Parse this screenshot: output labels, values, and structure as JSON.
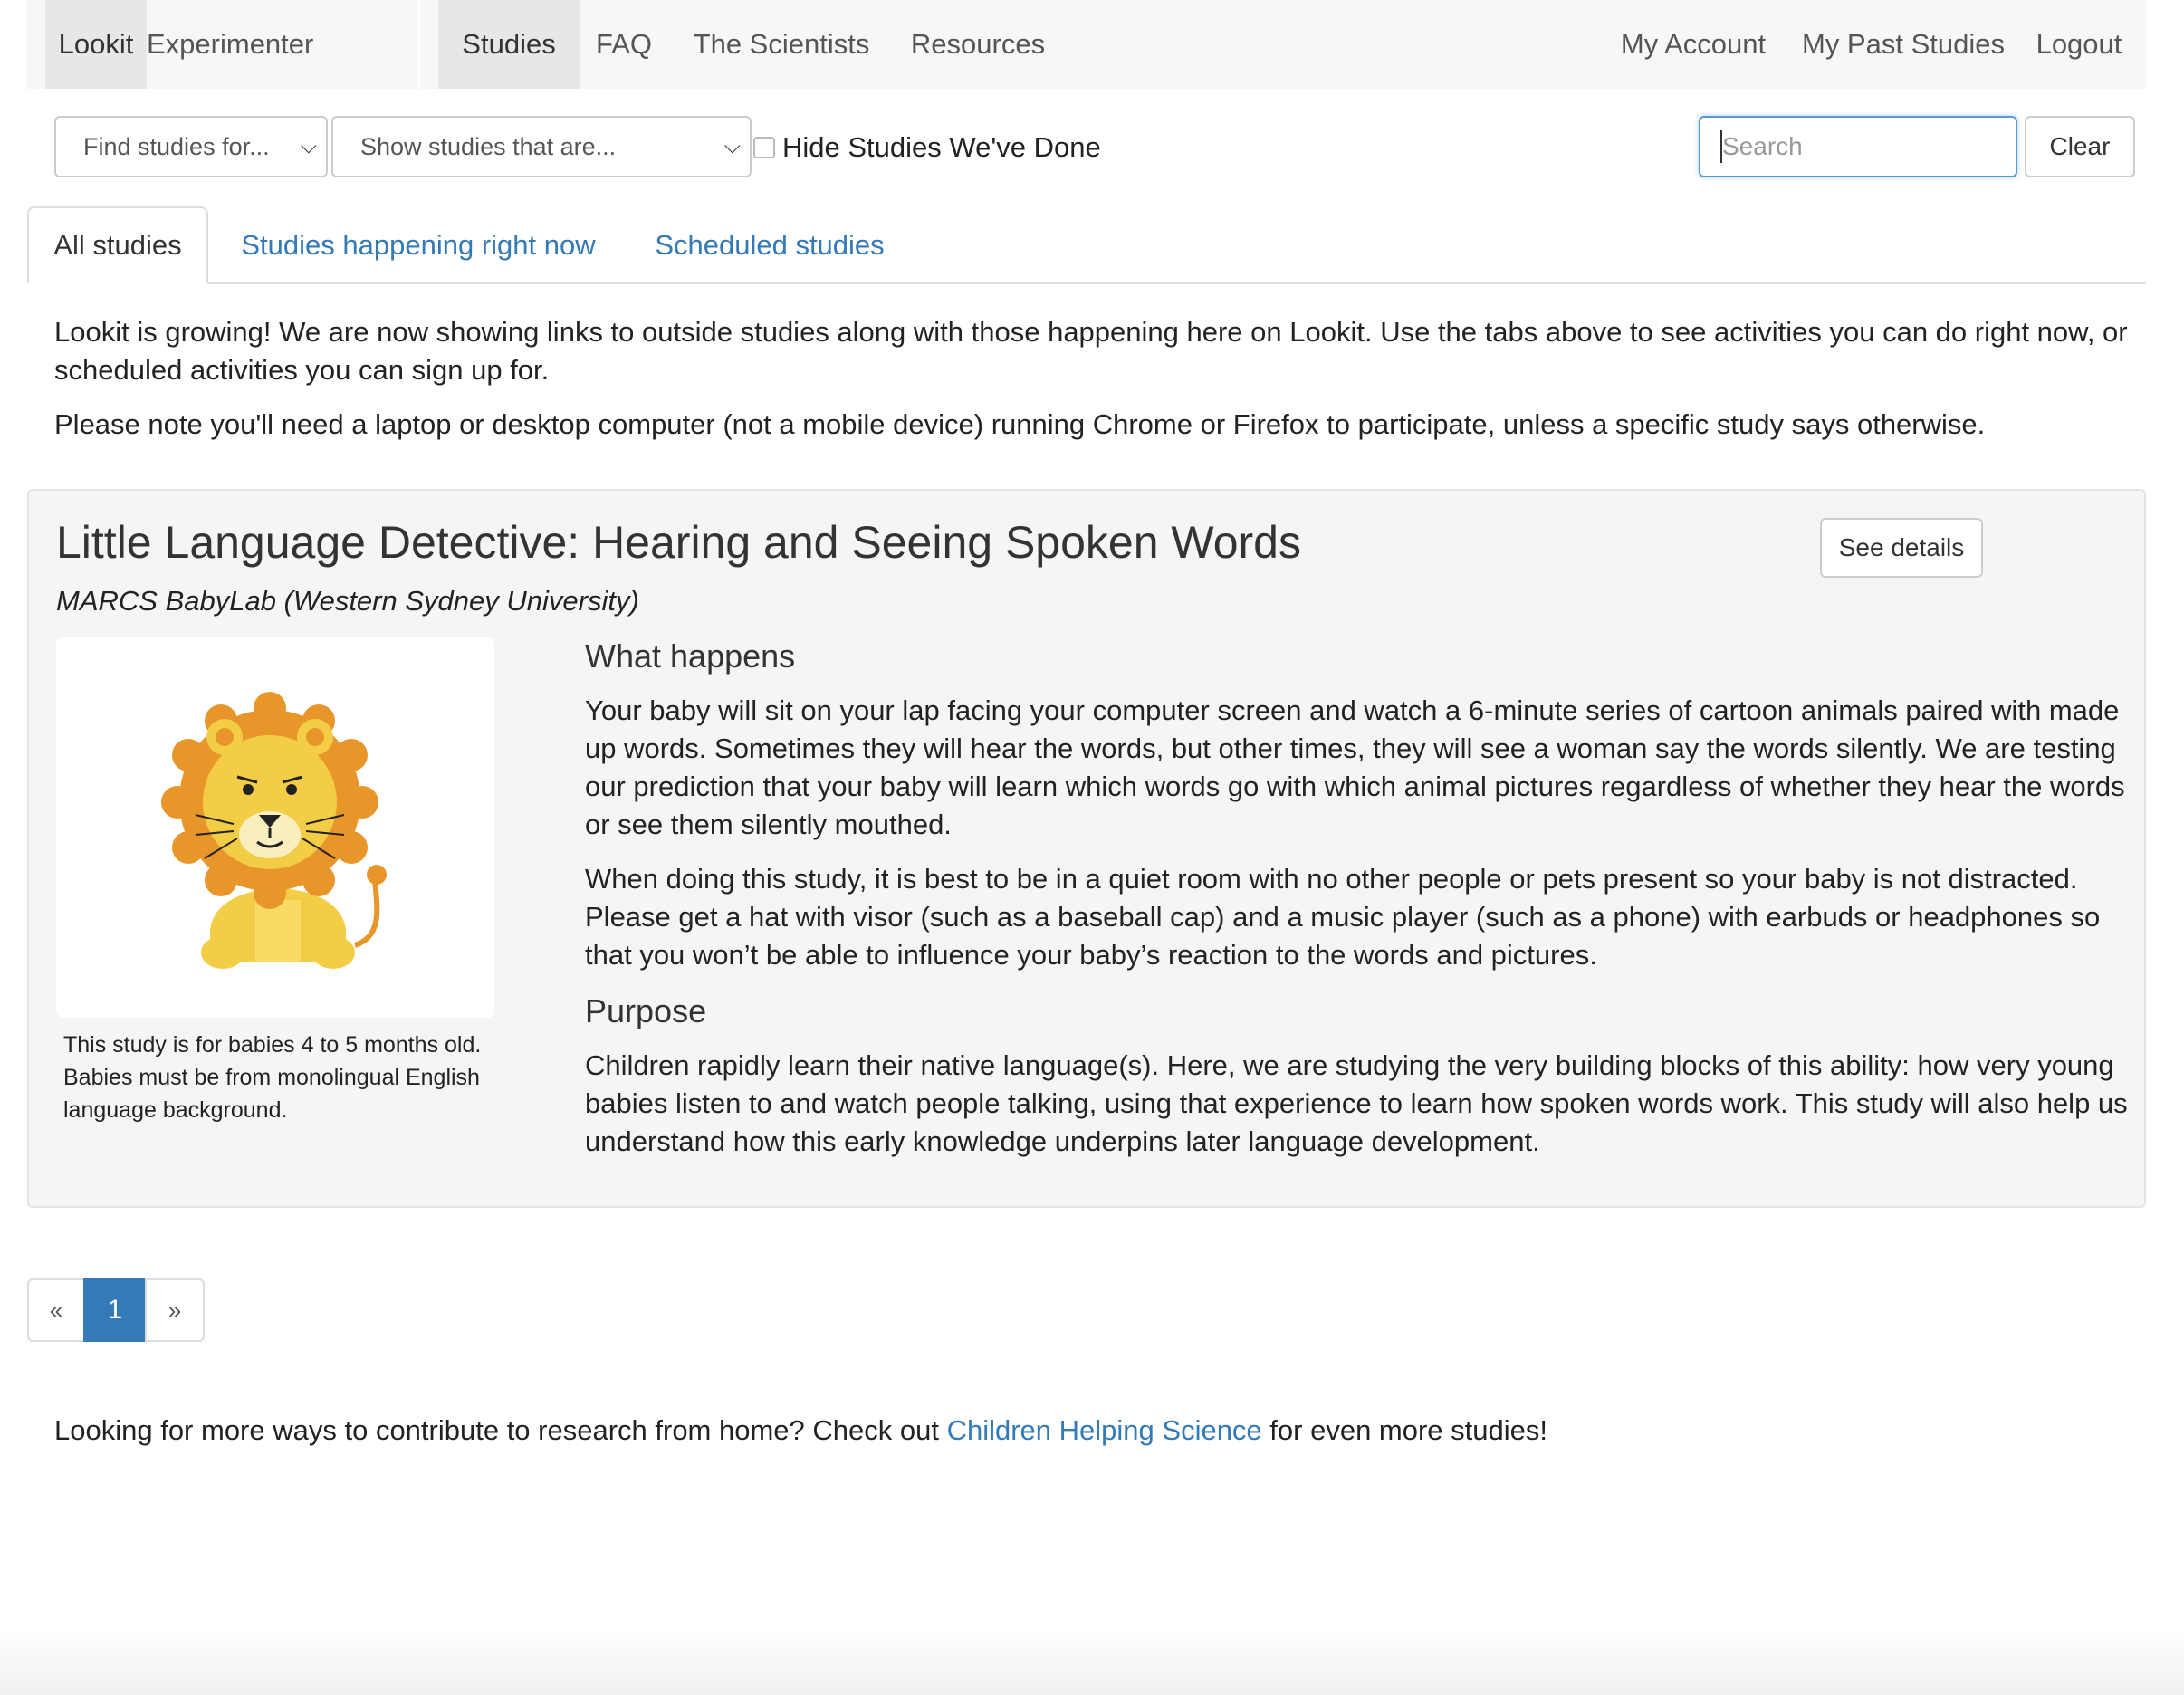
{
  "navbar": {
    "left": [
      "Lookit",
      "Experimenter"
    ],
    "center": [
      "Studies",
      "FAQ",
      "The Scientists",
      "Resources"
    ],
    "right": [
      "My Account",
      "My Past Studies",
      "Logout"
    ]
  },
  "filters": {
    "find_studies": "Find studies for...",
    "show_studies": "Show studies that are...",
    "hide_done_label": "Hide Studies We've Done",
    "hide_done_checked": false,
    "search_placeholder": "Search",
    "search_value": "",
    "clear_label": "Clear"
  },
  "tabs": [
    "All studies",
    "Studies happening right now",
    "Scheduled studies"
  ],
  "intro": {
    "line1": "Lookit is growing! We are now showing links to outside studies along with those happening here on Lookit. Use the tabs above to see activities you can do right now, or scheduled activities you can sign up for.",
    "line2": "Please note you'll need a laptop or desktop computer (not a mobile device) running Chrome or Firefox to participate, unless a specific study says otherwise."
  },
  "study": {
    "title": "Little Language Detective: Hearing and Seeing Spoken Words",
    "lab": "MARCS BabyLab (Western Sydney University)",
    "details_button": "See details",
    "image_icon": "lion-illustration",
    "eligibility": "This study is for babies 4 to 5 months old. Babies must be from monolingual English language background.",
    "what_happens_heading": "What happens",
    "what_happens_p1": "Your baby will sit on your lap facing your computer screen and watch a 6-minute series of cartoon animals paired with made up words. Sometimes they will hear the words, but other times, they will see a woman say the words silently. We are testing our prediction that your baby will learn which words go with which animal pictures regardless of whether they hear the words or see them silently mouthed.",
    "what_happens_p2": "When doing this study, it is best to be in a quiet room with no other people or pets present so your baby is not distracted. Please get a hat with visor (such as a baseball cap) and a music player (such as a phone) with earbuds or headphones so that you won’t be able to influence your baby’s reaction to the words and pictures.",
    "purpose_heading": "Purpose",
    "purpose_p": "Children rapidly learn their native language(s). Here, we are studying the very building blocks of this ability: how very young babies listen to and watch people talking, using that experience to learn how spoken words work. This study will also help us understand how this early knowledge underpins later language development."
  },
  "pagination": {
    "prev": "«",
    "current": "1",
    "next": "»"
  },
  "footer": {
    "prefix": "Looking for more ways to contribute to research from home? Check out ",
    "link": "Children Helping Science",
    "suffix": " for even more studies!"
  },
  "colors": {
    "accent": "#337ab7",
    "navbar_bg": "#f7f7f7",
    "card_bg": "#f5f5f5"
  }
}
